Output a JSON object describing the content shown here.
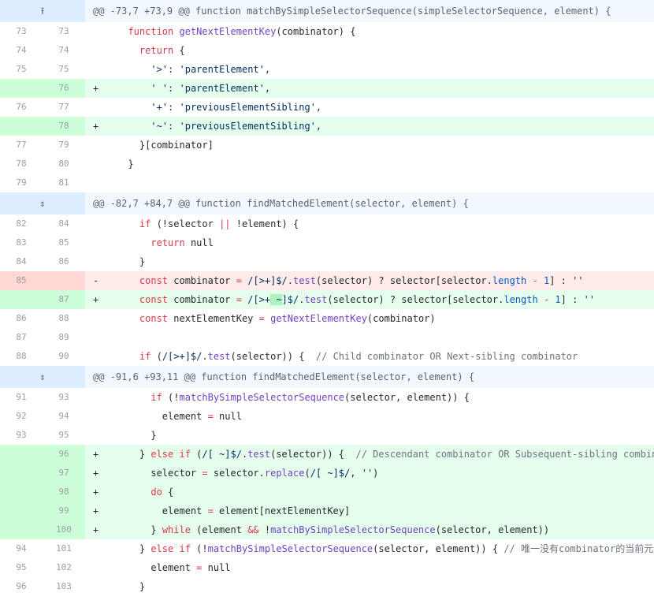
{
  "hunks": [
    {
      "header": "@@ -73,7 +73,9 @@ function matchBySimpleSelectorSequence(simpleSelectorSequence, element) {",
      "icon": "expand-up-icon"
    },
    {
      "header": "@@ -82,7 +84,7 @@ function findMatchedElement(selector, element) {",
      "icon": "expand-icon"
    },
    {
      "header": "@@ -91,6 +93,11 @@ function findMatchedElement(selector, element) {",
      "icon": "expand-icon"
    }
  ],
  "lines": [
    {
      "type": "ctx",
      "old": "73",
      "new": "73",
      "indent": "  ",
      "tokens": [
        [
          "k",
          "function "
        ],
        [
          "f",
          "getNextElementKey"
        ],
        [
          "",
          "(combinator) {"
        ]
      ]
    },
    {
      "type": "ctx",
      "old": "74",
      "new": "74",
      "indent": "    ",
      "tokens": [
        [
          "k",
          "return"
        ],
        [
          "",
          " {"
        ]
      ]
    },
    {
      "type": "ctx",
      "old": "75",
      "new": "75",
      "indent": "      ",
      "tokens": [
        [
          "s",
          "'>'"
        ],
        [
          "",
          ": "
        ],
        [
          "s",
          "'parentElement'"
        ],
        [
          "",
          ","
        ]
      ]
    },
    {
      "type": "add",
      "old": "",
      "new": "76",
      "indent": "      ",
      "tokens": [
        [
          "s",
          "' '"
        ],
        [
          "",
          ": "
        ],
        [
          "s",
          "'parentElement'"
        ],
        [
          "",
          ","
        ]
      ]
    },
    {
      "type": "ctx",
      "old": "76",
      "new": "77",
      "indent": "      ",
      "tokens": [
        [
          "s",
          "'+'"
        ],
        [
          "",
          ": "
        ],
        [
          "s",
          "'previousElementSibling'"
        ],
        [
          "",
          ","
        ]
      ]
    },
    {
      "type": "add",
      "old": "",
      "new": "78",
      "indent": "      ",
      "tokens": [
        [
          "s",
          "'~'"
        ],
        [
          "",
          ": "
        ],
        [
          "s",
          "'previousElementSibling'"
        ],
        [
          "",
          ","
        ]
      ]
    },
    {
      "type": "ctx",
      "old": "77",
      "new": "79",
      "indent": "    ",
      "tokens": [
        [
          "",
          "}[combinator]"
        ]
      ]
    },
    {
      "type": "ctx",
      "old": "78",
      "new": "80",
      "indent": "  ",
      "tokens": [
        [
          "",
          "}"
        ]
      ]
    },
    {
      "type": "ctx",
      "old": "79",
      "new": "81",
      "indent": "",
      "tokens": []
    },
    {
      "type": "hunk",
      "hunk": 1
    },
    {
      "type": "ctx",
      "old": "82",
      "new": "84",
      "indent": "    ",
      "tokens": [
        [
          "k",
          "if"
        ],
        [
          "",
          " (!selector "
        ],
        [
          "k",
          "||"
        ],
        [
          "",
          " !element) {"
        ]
      ]
    },
    {
      "type": "ctx",
      "old": "83",
      "new": "85",
      "indent": "      ",
      "tokens": [
        [
          "k",
          "return"
        ],
        [
          "",
          " null"
        ]
      ]
    },
    {
      "type": "ctx",
      "old": "84",
      "new": "86",
      "indent": "    ",
      "tokens": [
        [
          "",
          "}"
        ]
      ]
    },
    {
      "type": "del",
      "old": "85",
      "new": "",
      "indent": "    ",
      "tokens": [
        [
          "k",
          "const"
        ],
        [
          "",
          " combinator "
        ],
        [
          "k",
          "="
        ],
        [
          "",
          " "
        ],
        [
          "s",
          "/[>+]$/"
        ],
        [
          "",
          "."
        ],
        [
          "f",
          "test"
        ],
        [
          "",
          "(selector) ? selector[selector."
        ],
        [
          "n",
          "length"
        ],
        [
          "",
          " "
        ],
        [
          "k",
          "-"
        ],
        [
          "",
          " "
        ],
        [
          "n",
          "1"
        ],
        [
          "",
          "] : "
        ],
        [
          "s",
          "''"
        ]
      ]
    },
    {
      "type": "add",
      "old": "",
      "new": "87",
      "indent": "    ",
      "tokens": [
        [
          "k",
          "const"
        ],
        [
          "",
          " combinator "
        ],
        [
          "k",
          "="
        ],
        [
          "",
          " "
        ],
        [
          "s",
          "/[>+"
        ],
        [
          "hl s",
          " ~"
        ],
        [
          "s",
          "]$/"
        ],
        [
          "",
          "."
        ],
        [
          "f",
          "test"
        ],
        [
          "",
          "(selector) ? selector[selector."
        ],
        [
          "n",
          "length"
        ],
        [
          "",
          " "
        ],
        [
          "k",
          "-"
        ],
        [
          "",
          " "
        ],
        [
          "n",
          "1"
        ],
        [
          "",
          "] : "
        ],
        [
          "s",
          "''"
        ]
      ]
    },
    {
      "type": "ctx",
      "old": "86",
      "new": "88",
      "indent": "    ",
      "tokens": [
        [
          "k",
          "const"
        ],
        [
          "",
          " nextElementKey "
        ],
        [
          "k",
          "="
        ],
        [
          "",
          " "
        ],
        [
          "f",
          "getNextElementKey"
        ],
        [
          "",
          "(combinator)"
        ]
      ]
    },
    {
      "type": "ctx",
      "old": "87",
      "new": "89",
      "indent": "",
      "tokens": []
    },
    {
      "type": "ctx",
      "old": "88",
      "new": "90",
      "indent": "    ",
      "tokens": [
        [
          "k",
          "if"
        ],
        [
          "",
          " ("
        ],
        [
          "s",
          "/[>+]$/"
        ],
        [
          "",
          "."
        ],
        [
          "f",
          "test"
        ],
        [
          "",
          "(selector)) {  "
        ],
        [
          "c",
          "// Child combinator OR Next-sibling combinator"
        ]
      ]
    },
    {
      "type": "hunk",
      "hunk": 2
    },
    {
      "type": "ctx",
      "old": "91",
      "new": "93",
      "indent": "      ",
      "tokens": [
        [
          "k",
          "if"
        ],
        [
          "",
          " (!"
        ],
        [
          "f",
          "matchBySimpleSelectorSequence"
        ],
        [
          "",
          "(selector, element)) {"
        ]
      ]
    },
    {
      "type": "ctx",
      "old": "92",
      "new": "94",
      "indent": "        ",
      "tokens": [
        [
          "",
          "element "
        ],
        [
          "k",
          "="
        ],
        [
          "",
          " null"
        ]
      ]
    },
    {
      "type": "ctx",
      "old": "93",
      "new": "95",
      "indent": "      ",
      "tokens": [
        [
          "",
          "}"
        ]
      ]
    },
    {
      "type": "add",
      "old": "",
      "new": "96",
      "indent": "    ",
      "tokens": [
        [
          "",
          "} "
        ],
        [
          "k",
          "else if"
        ],
        [
          "",
          " ("
        ],
        [
          "s",
          "/[ ~]$/"
        ],
        [
          "",
          "."
        ],
        [
          "f",
          "test"
        ],
        [
          "",
          "(selector)) {  "
        ],
        [
          "c",
          "// Descendant combinator OR Subsequent-sibling combinator"
        ]
      ]
    },
    {
      "type": "add",
      "old": "",
      "new": "97",
      "indent": "      ",
      "tokens": [
        [
          "",
          "selector "
        ],
        [
          "k",
          "="
        ],
        [
          "",
          " selector."
        ],
        [
          "f",
          "replace"
        ],
        [
          "",
          "("
        ],
        [
          "s",
          "/[ ~]$/"
        ],
        [
          "",
          ", "
        ],
        [
          "s",
          "''"
        ],
        [
          "",
          ")"
        ]
      ]
    },
    {
      "type": "add",
      "old": "",
      "new": "98",
      "indent": "      ",
      "tokens": [
        [
          "k",
          "do"
        ],
        [
          "",
          " {"
        ]
      ]
    },
    {
      "type": "add",
      "old": "",
      "new": "99",
      "indent": "        ",
      "tokens": [
        [
          "",
          "element "
        ],
        [
          "k",
          "="
        ],
        [
          "",
          " element[nextElementKey]"
        ]
      ]
    },
    {
      "type": "add",
      "old": "",
      "new": "100",
      "indent": "      ",
      "tokens": [
        [
          "",
          "} "
        ],
        [
          "k",
          "while"
        ],
        [
          "",
          " (element "
        ],
        [
          "k",
          "&&"
        ],
        [
          "",
          " !"
        ],
        [
          "f",
          "matchBySimpleSelectorSequence"
        ],
        [
          "",
          "(selector, element))"
        ]
      ]
    },
    {
      "type": "ctx",
      "old": "94",
      "new": "101",
      "indent": "    ",
      "tokens": [
        [
          "",
          "} "
        ],
        [
          "k",
          "else if"
        ],
        [
          "",
          " (!"
        ],
        [
          "f",
          "matchBySimpleSelectorSequence"
        ],
        [
          "",
          "(selector, element)) { "
        ],
        [
          "c",
          "// 唯一没有combinator的当前元素"
        ]
      ]
    },
    {
      "type": "ctx",
      "old": "95",
      "new": "102",
      "indent": "      ",
      "tokens": [
        [
          "",
          "element "
        ],
        [
          "k",
          "="
        ],
        [
          "",
          " null"
        ]
      ]
    },
    {
      "type": "ctx",
      "old": "96",
      "new": "103",
      "indent": "    ",
      "tokens": [
        [
          "",
          "}"
        ]
      ]
    }
  ],
  "markers": {
    "add": "+",
    "del": "-",
    "ctx": " "
  },
  "icons": {
    "expand-up-icon": "⭱",
    "expand-icon": "⇕"
  }
}
